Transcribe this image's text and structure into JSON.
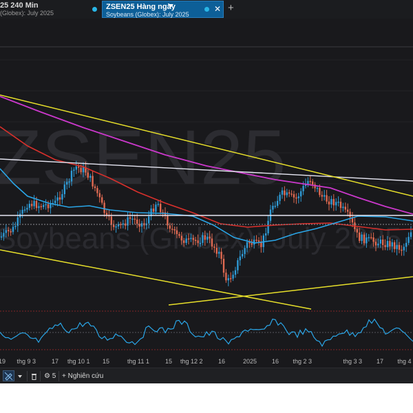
{
  "tabs": [
    {
      "line1": "25 240 Min",
      "line2": "(Globex): July 2025"
    },
    {
      "line1": "ZSEN25 Hàng ngày",
      "line2": "Soybeans (Globex): July 2025"
    }
  ],
  "watermark": {
    "symbol": "ZSEN25",
    "description": "Soybeans (Globex): July 2025"
  },
  "x_axis_labels": [
    "19",
    "thg 9 3",
    "17",
    "thg 10 1",
    "15",
    "thg 11 1",
    "15",
    "thg 12 2",
    "16",
    "2025",
    "16",
    "thg 2 3",
    "thg 3 3",
    "17",
    "thg 4"
  ],
  "toolbar": {
    "indicator_count": "5",
    "research_label": "+ Nghiên cứu"
  },
  "colors": {
    "background": "#19191c",
    "up_candle": "#2f9bd6",
    "down_candle": "#e06a52",
    "ma_red": "#d9302c",
    "ma_blue": "#2aa6e8",
    "ma_magenta": "#cc38cc",
    "trendline_yellow": "#e8e02a",
    "hline_white": "#e6e6f2",
    "oscillator": "#2aa6e8",
    "active_tab": "#0d5f98"
  }
}
